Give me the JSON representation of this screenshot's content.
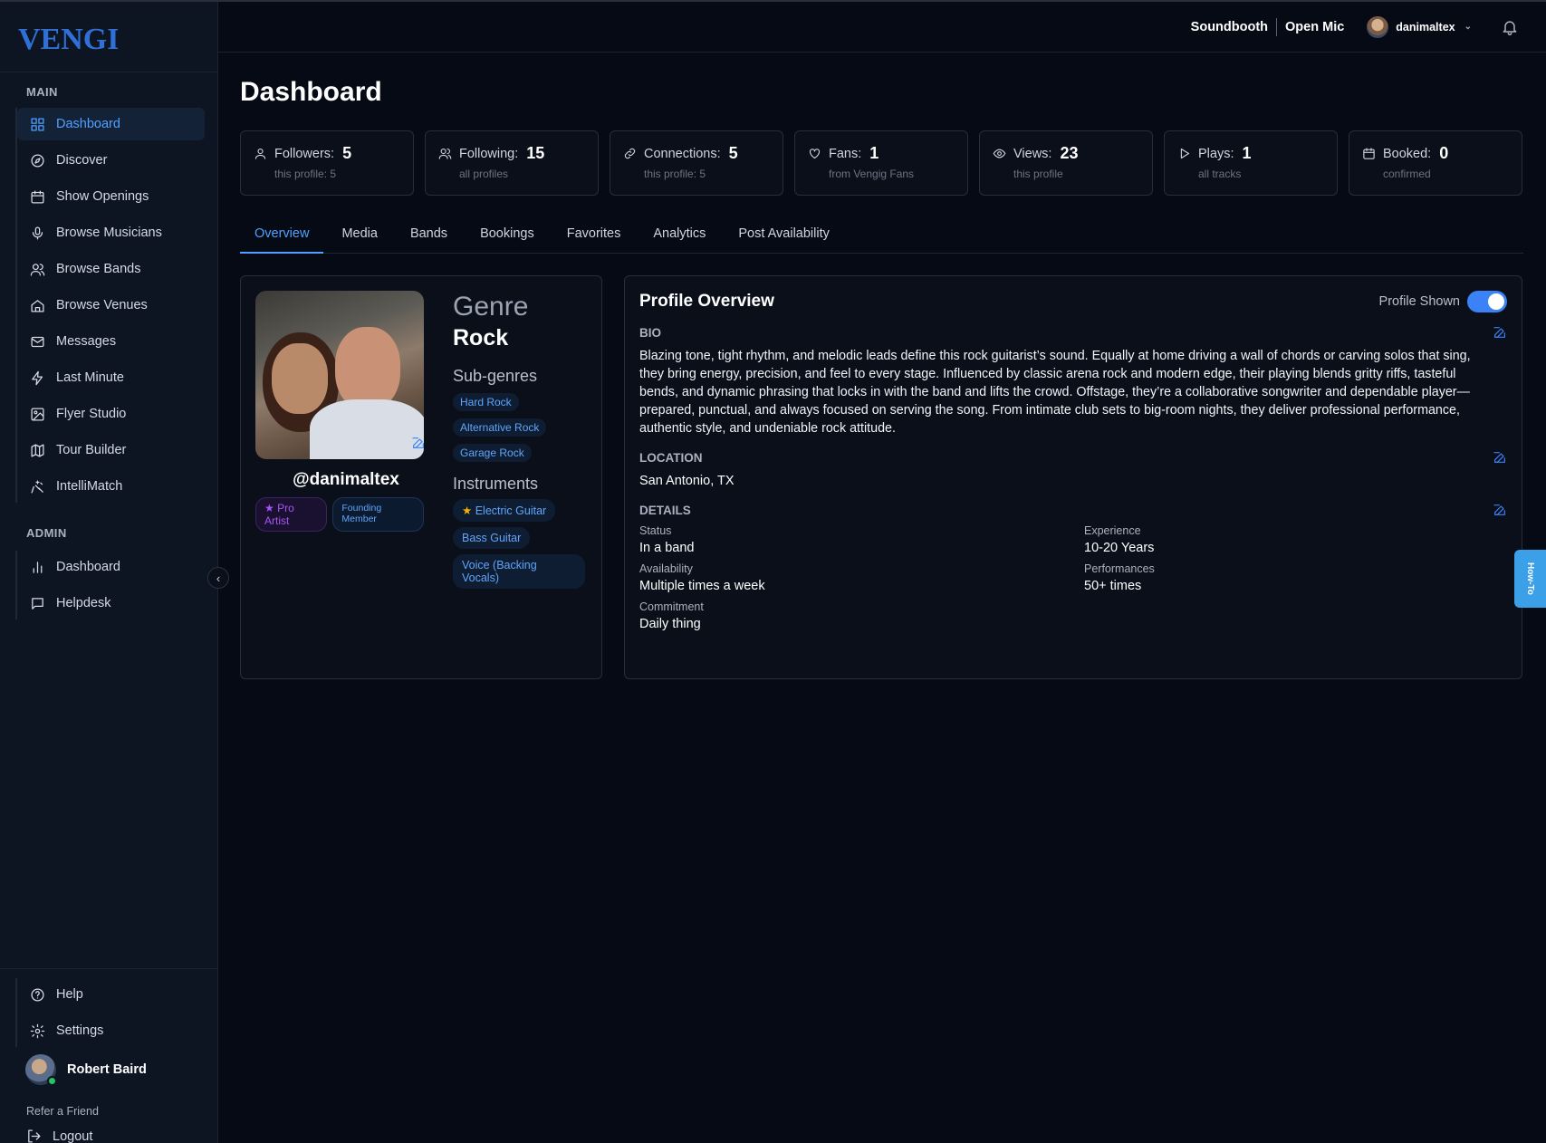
{
  "brand": {
    "logo_text": "VENGIG"
  },
  "sidebar": {
    "main_label": "MAIN",
    "admin_label": "ADMIN",
    "main_items": [
      {
        "label": "Dashboard",
        "icon": "grid-icon"
      },
      {
        "label": "Discover",
        "icon": "compass-icon"
      },
      {
        "label": "Show Openings",
        "icon": "calendar-icon"
      },
      {
        "label": "Browse Musicians",
        "icon": "microphone-icon"
      },
      {
        "label": "Browse Bands",
        "icon": "users-icon"
      },
      {
        "label": "Browse Venues",
        "icon": "home-icon"
      },
      {
        "label": "Messages",
        "icon": "mail-icon"
      },
      {
        "label": "Last Minute",
        "icon": "zap-icon"
      },
      {
        "label": "Flyer Studio",
        "icon": "image-icon"
      },
      {
        "label": "Tour Builder",
        "icon": "map-icon"
      },
      {
        "label": "IntelliMatch",
        "icon": "sparkles-icon"
      }
    ],
    "admin_items": [
      {
        "label": "Dashboard",
        "icon": "bar-chart-icon"
      },
      {
        "label": "Helpdesk",
        "icon": "message-square-icon"
      }
    ],
    "help": "Help",
    "settings": "Settings",
    "user_name": "Robert Baird",
    "refer": "Refer a Friend",
    "logout": "Logout"
  },
  "topbar": {
    "soundbooth": "Soundbooth",
    "open_mic": "Open Mic",
    "username": "danimaltex"
  },
  "page": {
    "title": "Dashboard"
  },
  "stats": [
    {
      "label": "Followers:",
      "value": "5",
      "sub": "this profile: 5",
      "icon": "user-icon"
    },
    {
      "label": "Following:",
      "value": "15",
      "sub": "all profiles",
      "icon": "users-icon"
    },
    {
      "label": "Connections:",
      "value": "5",
      "sub": "this profile: 5",
      "icon": "link-icon"
    },
    {
      "label": "Fans:",
      "value": "1",
      "sub": "from Vengig Fans",
      "icon": "heart-icon"
    },
    {
      "label": "Views:",
      "value": "23",
      "sub": "this profile",
      "icon": "eye-icon"
    },
    {
      "label": "Plays:",
      "value": "1",
      "sub": "all tracks",
      "icon": "play-icon"
    },
    {
      "label": "Booked:",
      "value": "0",
      "sub": "confirmed",
      "icon": "calendar-icon"
    }
  ],
  "tabs": [
    "Overview",
    "Media",
    "Bands",
    "Bookings",
    "Favorites",
    "Analytics",
    "Post Availability"
  ],
  "profile": {
    "handle": "@danimaltex",
    "badge_pro": "Pro Artist",
    "badge_founding": "Founding Member",
    "genre_label": "Genre",
    "genre": "Rock",
    "subgenres_label": "Sub-genres",
    "subgenres": [
      "Hard Rock",
      "Alternative Rock",
      "Garage Rock"
    ],
    "instruments_label": "Instruments",
    "instruments": [
      "Electric Guitar",
      "Bass Guitar",
      "Voice (Backing Vocals)"
    ]
  },
  "overview": {
    "title": "Profile Overview",
    "profile_shown": "Profile Shown",
    "bio_label": "BIO",
    "bio": "Blazing tone, tight rhythm, and melodic leads define this rock guitarist’s sound. Equally at home driving a wall of chords or carving solos that sing, they bring energy, precision, and feel to every stage. Influenced by classic arena rock and modern edge, their playing blends gritty riffs, tasteful bends, and dynamic phrasing that locks in with the band and lifts the crowd. Offstage, they’re a collaborative songwriter and dependable player—prepared, punctual, and always focused on serving the song. From intimate club sets to big-room nights, they deliver professional performance, authentic style, and undeniable rock attitude.",
    "location_label": "LOCATION",
    "location": "San Antonio, TX",
    "details_label": "DETAILS",
    "details": {
      "status_label": "Status",
      "status": "In a band",
      "experience_label": "Experience",
      "experience": "10-20 Years",
      "availability_label": "Availability",
      "availability": "Multiple times a week",
      "performances_label": "Performances",
      "performances": "50+ times",
      "commitment_label": "Commitment",
      "commitment": "Daily thing"
    }
  },
  "howto": "How-To",
  "colors": {
    "accent": "#4ea1ff",
    "toggle": "#3b82f6",
    "pro": "#a855f7",
    "online": "#22c55e"
  }
}
